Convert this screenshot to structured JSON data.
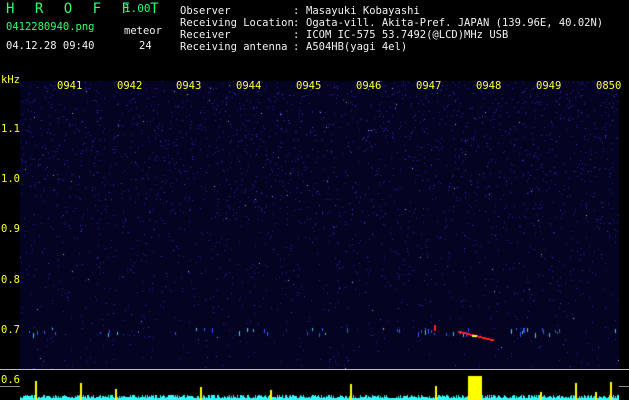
{
  "header": {
    "app_title": "H R O F F T",
    "version": "1.00",
    "filename": "0412280940.png",
    "datetime": "04.12.28 09:40",
    "meteor_label": "meteor",
    "meteor_count": "24"
  },
  "station": [
    {
      "label": "Observer",
      "sep": ":",
      "value": "Masayuki Kobayashi"
    },
    {
      "label": "Receiving Location",
      "sep": ":",
      "value": "Ogata-vill. Akita-Pref. JAPAN (139.96E, 40.02N)"
    },
    {
      "label": "Receiver",
      "sep": ":",
      "value": "ICOM IC-575 53.7492(@LCD)MHz USB"
    },
    {
      "label": "Receiving antenna",
      "sep": ":",
      "value": "A504HB(yagi 4el)"
    }
  ],
  "axis": {
    "unit": "kHz",
    "time_ticks": [
      "0941",
      "0942",
      "0943",
      "0944",
      "0945",
      "0946",
      "0947",
      "0948",
      "0949",
      "0850"
    ],
    "freq_ticks": [
      "1.1",
      "1.0",
      "0.9",
      "0.8",
      "0.7",
      "0.6"
    ]
  },
  "colors": {
    "background": "#000000",
    "label_green": "#33ff66",
    "label_white": "#f2f2f2",
    "tick_yellow": "#ffff33",
    "noise_blue": "#2a2ad0",
    "meteor_red": "#ff2020",
    "monitor_cyan": "#33ffff",
    "monitor_yellow": "#ffff00"
  }
}
